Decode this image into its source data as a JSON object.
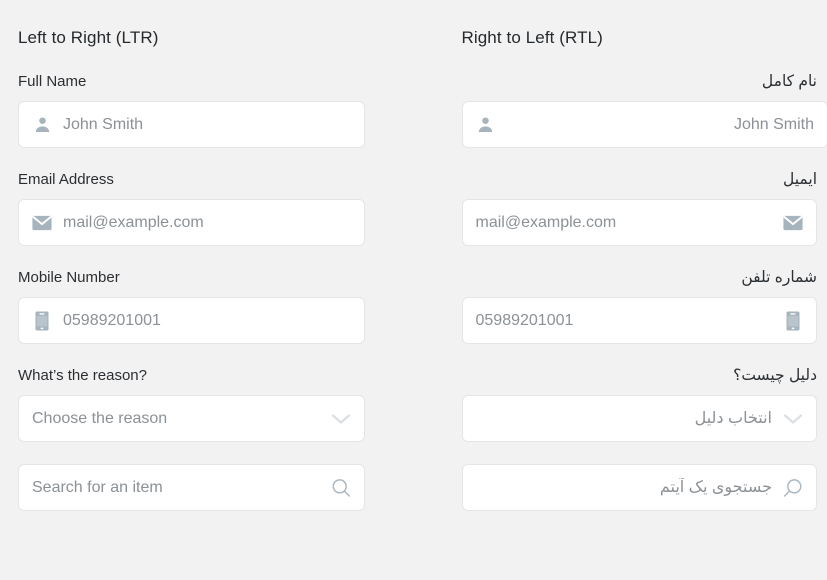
{
  "columns": [
    {
      "id": "ltr",
      "direction": "ltr",
      "title": "Left to Right (LTR)",
      "fields": [
        {
          "name": "full-name",
          "label": "Full Name",
          "placeholder": "John Smith",
          "icon": "person-icon",
          "control": "text-input"
        },
        {
          "name": "email-address",
          "label": "Email Address",
          "placeholder": "mail@example.com",
          "icon": "envelope-icon",
          "control": "text-input"
        },
        {
          "name": "mobile-number",
          "label": "Mobile Number",
          "placeholder": "05989201001",
          "icon": "mobile-icon",
          "control": "text-input"
        },
        {
          "name": "reason-select",
          "label": "What’s the reason?",
          "placeholder": "Choose the reason",
          "icon": "chevron-down-icon",
          "control": "select"
        },
        {
          "name": "item-search",
          "label": "",
          "placeholder": "Search for an item",
          "icon": "search-icon",
          "control": "search"
        }
      ]
    },
    {
      "id": "rtl",
      "direction": "rtl",
      "title": "Right to Left (RTL)",
      "fields": [
        {
          "name": "full-name",
          "label": "نام کامل",
          "placeholder": "John Smith",
          "icon": "person-icon",
          "control": "text-input"
        },
        {
          "name": "email-address",
          "label": "ایمیل",
          "placeholder": "mail@example.com",
          "icon": "envelope-icon",
          "control": "text-input"
        },
        {
          "name": "mobile-number",
          "label": "شماره تلفن",
          "placeholder": "05989201001",
          "icon": "mobile-icon",
          "control": "text-input"
        },
        {
          "name": "reason-select",
          "label": "دلیل چیست؟",
          "placeholder": "انتخاب دلیل",
          "icon": "chevron-down-icon",
          "control": "select"
        },
        {
          "name": "item-search",
          "label": "",
          "placeholder": "جستجوی یک آیتم",
          "icon": "search-icon",
          "control": "search"
        }
      ]
    }
  ],
  "colors": {
    "page_background": "#f2f2f2",
    "field_background": "#ffffff",
    "field_border": "#e3e5e7",
    "label_text": "#2b2f33",
    "placeholder_text": "#8b9196",
    "icon_fill": "#a6b4bd",
    "chevron": "#dcdfe2"
  }
}
